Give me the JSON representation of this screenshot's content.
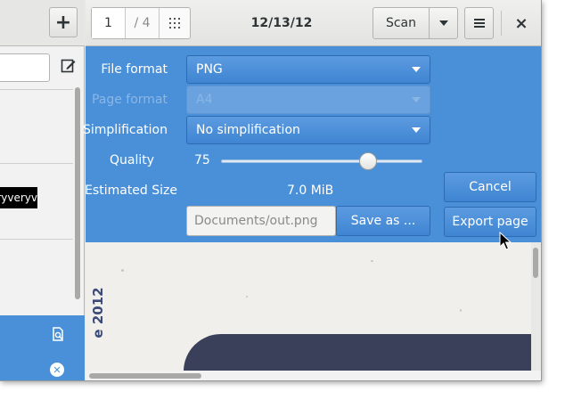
{
  "sidebar": {
    "add_label": "+",
    "search_value": "",
    "highlight_text": "ryveryv"
  },
  "header": {
    "current_page": "1",
    "total_pages": "/ 4",
    "title": "12/13/12",
    "scan_label": "Scan",
    "close_label": "×"
  },
  "export": {
    "file_format_label": "File format",
    "file_format_value": "PNG",
    "page_format_label": "Page format",
    "page_format_value": "A4",
    "simplification_label": "Simplification",
    "simplification_value": "No simplification",
    "quality_label": "Quality",
    "quality_value": "75",
    "quality_fraction": 0.75,
    "estimated_size_label": "Estimated Size",
    "estimated_size_value": "7.0 MiB",
    "path_placeholder": "Documents/out.png",
    "save_as_label": "Save as ...",
    "cancel_label": "Cancel",
    "export_label": "Export page"
  },
  "preview": {
    "rotated_text": "e 2012"
  },
  "colors": {
    "accent": "#4a90d9",
    "header_bg": "#e8e8e7"
  }
}
